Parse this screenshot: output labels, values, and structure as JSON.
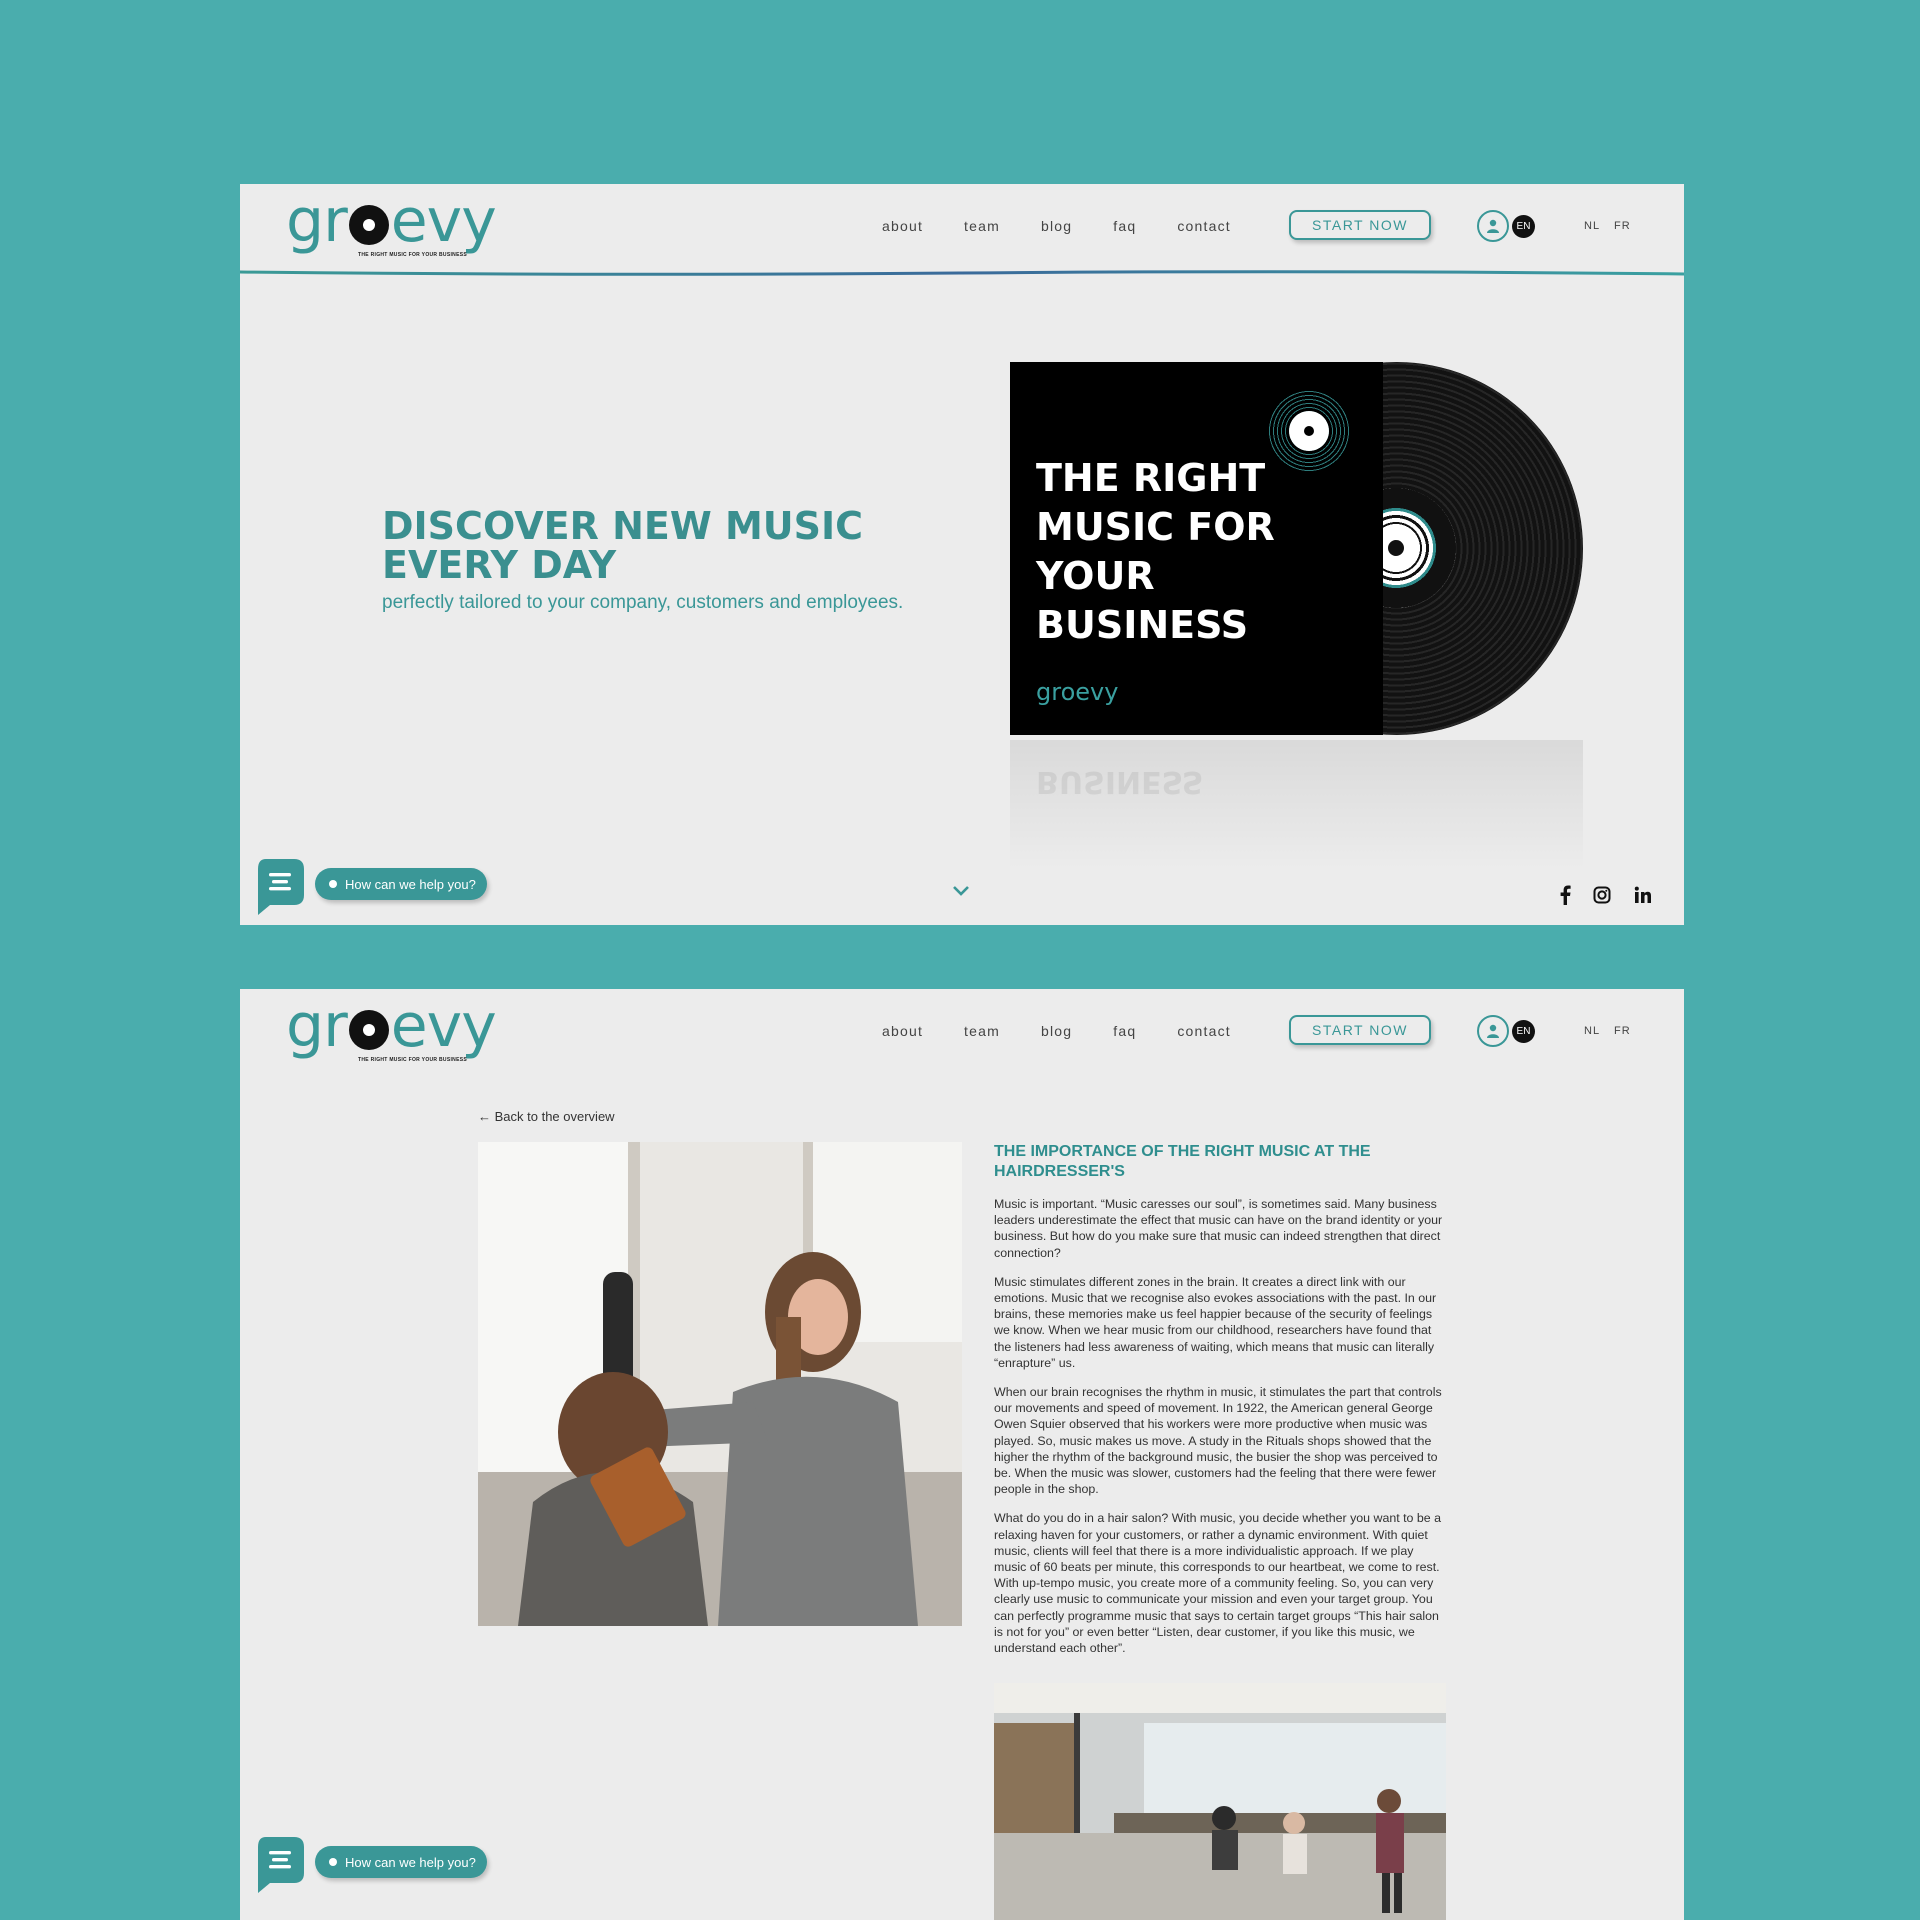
{
  "brand": {
    "logo_text": "groevy",
    "tagline": "THE RIGHT MUSIC FOR YOUR BUSINESS"
  },
  "nav": {
    "items": [
      "about",
      "team",
      "blog",
      "faq",
      "contact"
    ],
    "cta": "START NOW",
    "active_lang": "EN",
    "other_langs": [
      "NL",
      "FR"
    ]
  },
  "hero": {
    "title": "DISCOVER NEW MUSIC EVERY DAY",
    "subtitle": "perfectly tailored to your company, customers and employees.",
    "album_text": "THE RIGHT MUSIC FOR YOUR BUSINESS",
    "album_logo": "groevy",
    "reflection_text": "BUSINESS"
  },
  "chat": {
    "label": "How can we help you?"
  },
  "article": {
    "back_link": "← Back to the overview",
    "title": "THE IMPORTANCE OF THE RIGHT MUSIC AT THE HAIRDRESSER'S",
    "paragraphs": [
      "Music is important. “Music caresses our soul”, is sometimes said. Many business leaders underestimate the effect that music can have on the brand identity or your business. But how do you make sure that music can indeed strengthen that direct connection?",
      "Music stimulates different zones in the brain. It creates a direct link with our emotions. Music that we recognise also evokes associations with the past. In our brains, these memories make us feel happier because of the security of feelings we know. When we hear music from our childhood, researchers have found that the listeners had less awareness of waiting, which means that music can literally “enrapture” us.",
      "When our brain recognises the rhythm in music, it stimulates the part that controls our movements and speed of movement. In 1922, the American general George Owen Squier observed that his workers were more productive when music was played. So, music makes us move. A study in the Rituals shops showed that the higher the rhythm of the background music, the busier the shop was perceived to be. When the music was slower, customers had the feeling that there were fewer people in the shop.",
      "What do you do in a hair salon? With music, you decide whether you want to be a relaxing haven for your customers, or rather a dynamic environment. With quiet music, clients will feel that there is a more individualistic approach. If we play music of 60 beats per minute, this corresponds to our heartbeat, we come to rest. With up-tempo music, you create more of a community feeling. So, you can very clearly use music to communicate your mission and even your target group. You can perfectly programme music that says to certain target groups “This hair salon is not for you” or even better “Listen, dear customer, if you like this music, we understand each other”."
    ]
  },
  "colors": {
    "page_bg": "#4aadad",
    "panel_bg": "#ececec",
    "brand_teal": "#3a9797",
    "dark": "#111111"
  },
  "icons": [
    "user-icon",
    "chevron-down-icon",
    "facebook-icon",
    "instagram-icon",
    "linkedin-icon",
    "chat-icon",
    "arrow-left-icon"
  ]
}
